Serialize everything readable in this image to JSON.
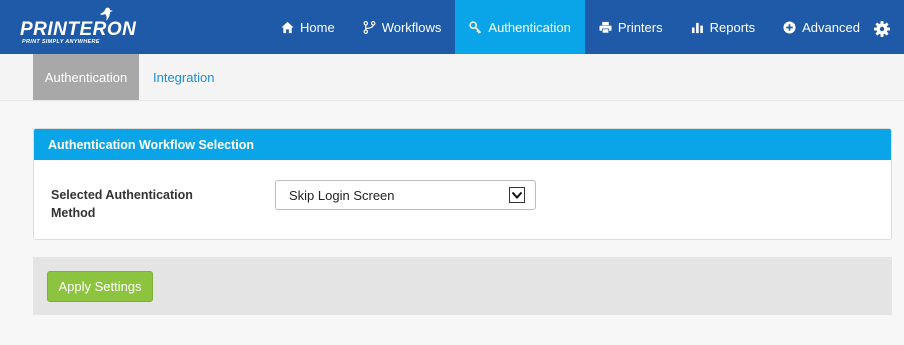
{
  "logo": {
    "name": "PRINTERON",
    "tagline": "PRINT SIMPLY ANYWHERE"
  },
  "nav": {
    "items": [
      {
        "label": "Home",
        "icon": "home-icon"
      },
      {
        "label": "Workflows",
        "icon": "workflow-icon"
      },
      {
        "label": "Authentication",
        "icon": "key-icon",
        "active": true
      },
      {
        "label": "Printers",
        "icon": "printer-icon"
      },
      {
        "label": "Reports",
        "icon": "bar-chart-icon"
      },
      {
        "label": "Advanced",
        "icon": "plus-circle-icon"
      }
    ],
    "settings_icon": "gear-icon"
  },
  "subtabs": {
    "items": [
      {
        "label": "Authentication",
        "active": true
      },
      {
        "label": "Integration",
        "active": false
      }
    ]
  },
  "panel": {
    "title": "Authentication Workflow Selection",
    "field_label": "Selected Authentication Method",
    "selected_value": "Skip Login Screen"
  },
  "actions": {
    "apply_label": "Apply Settings"
  },
  "colors": {
    "topbar": "#1e5aa8",
    "active_nav": "#0aa4e8",
    "panel_header": "#0aa4e8",
    "apply_button": "#8cc43f",
    "link": "#1b8fd6"
  }
}
